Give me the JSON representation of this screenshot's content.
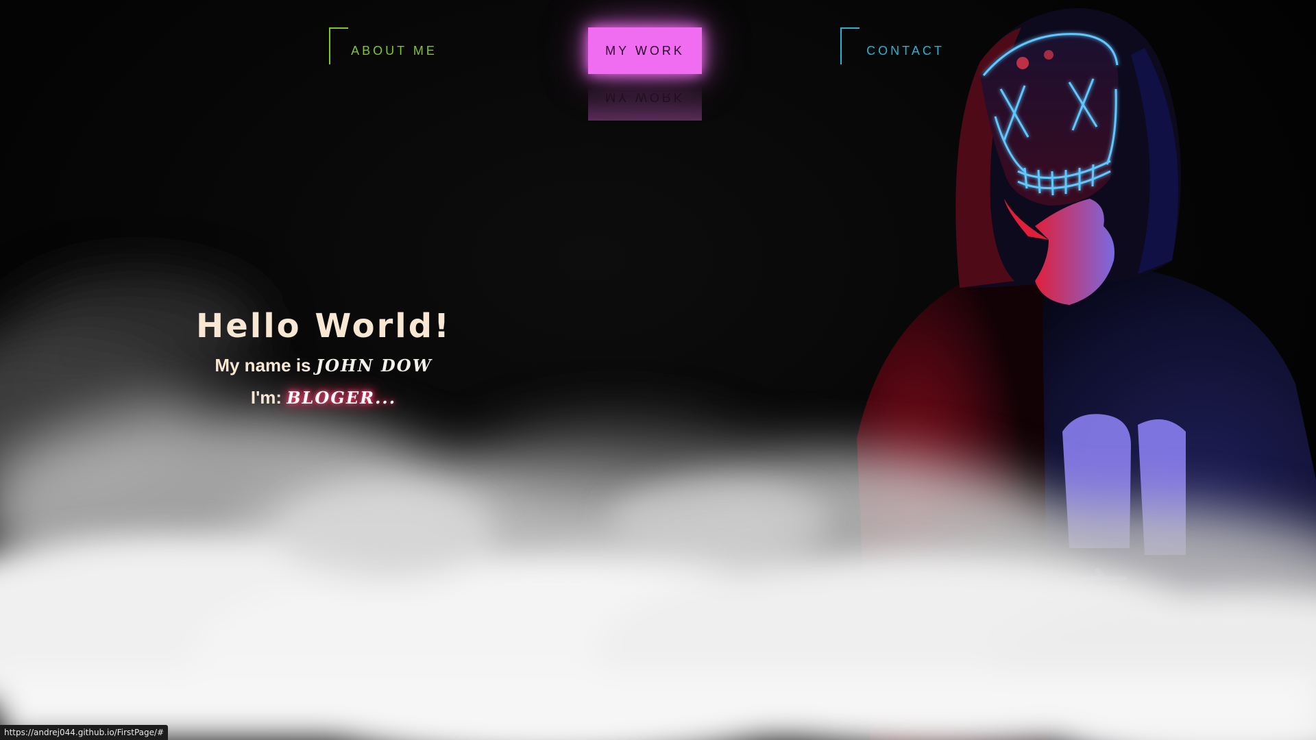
{
  "nav": {
    "about_label": "ABOUT ME",
    "work_label": "MY WORK",
    "contact_label": "CONTACT"
  },
  "hero": {
    "title": "Hello World!",
    "name_prefix": "My name is ",
    "name": "JOHN DOW",
    "role_prefix": "I'm: ",
    "role": "BLOGER..."
  },
  "status": {
    "url": "https://andrej044.github.io/FirstPage/#"
  },
  "colors": {
    "about": "#7ecb1c",
    "work": "#f06cf0",
    "contact": "#1fb6d8",
    "hero_text": "#f8e7d2",
    "role_glow": "#ff3b6b"
  }
}
